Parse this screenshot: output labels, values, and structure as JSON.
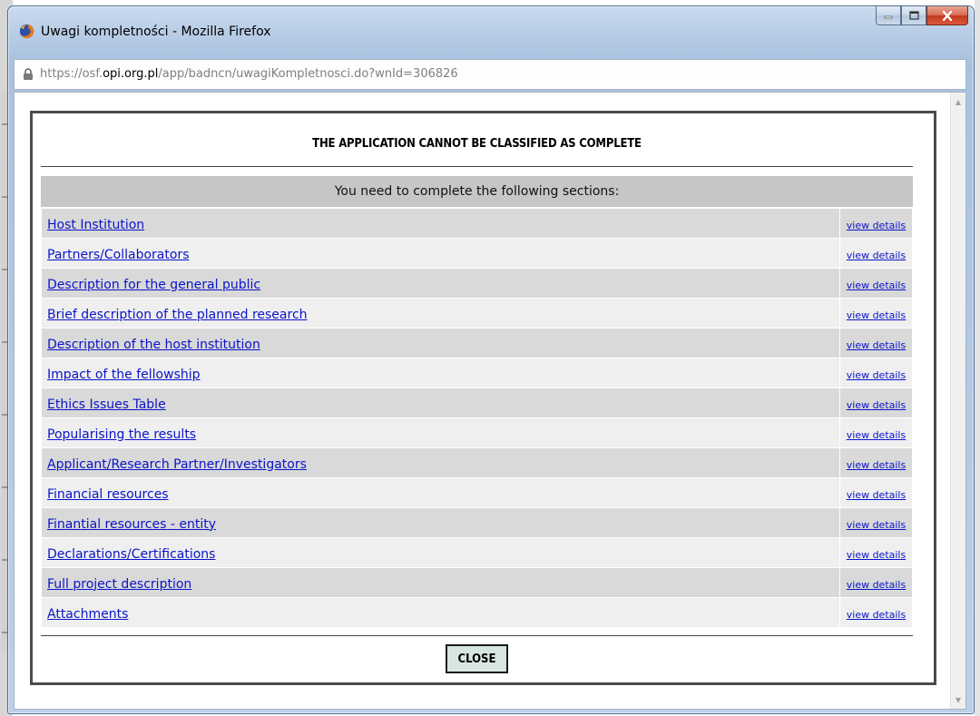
{
  "window": {
    "title": "Uwagi kompletności - Mozilla Firefox",
    "icon": "firefox-icon",
    "buttons": [
      "minimize",
      "maximize",
      "close"
    ]
  },
  "address": {
    "prefix": "https://osf.",
    "domain": "opi.org.pl",
    "path": "/app/badncn/uwagiKompletnosci.do?wnId=306826"
  },
  "dialog": {
    "heading": "THE APPLICATION CANNOT BE CLASSIFIED AS COMPLETE",
    "subheading": "You need to complete the following sections:",
    "details_label": "view details",
    "sections": [
      {
        "label": "Host Institution"
      },
      {
        "label": "Partners/Collaborators"
      },
      {
        "label": "Description for the general public"
      },
      {
        "label": "Brief description of the planned research"
      },
      {
        "label": "Description of the host institution"
      },
      {
        "label": "Impact of the fellowship"
      },
      {
        "label": "Ethics Issues Table"
      },
      {
        "label": "Popularising the results"
      },
      {
        "label": "Applicant/Research Partner/Investigators"
      },
      {
        "label": "Financial resources"
      },
      {
        "label": "Finantial resources - entity"
      },
      {
        "label": "Declarations/Certifications"
      },
      {
        "label": "Full project description"
      },
      {
        "label": "Attachments"
      }
    ],
    "close_label": "CLOSE"
  },
  "colors": {
    "link": "#0a14c8",
    "row_odd": "#d9d9d9",
    "row_even": "#efefef",
    "subheader_bg": "#c6c6c6",
    "close_button_bg": "#d8e6e2"
  }
}
